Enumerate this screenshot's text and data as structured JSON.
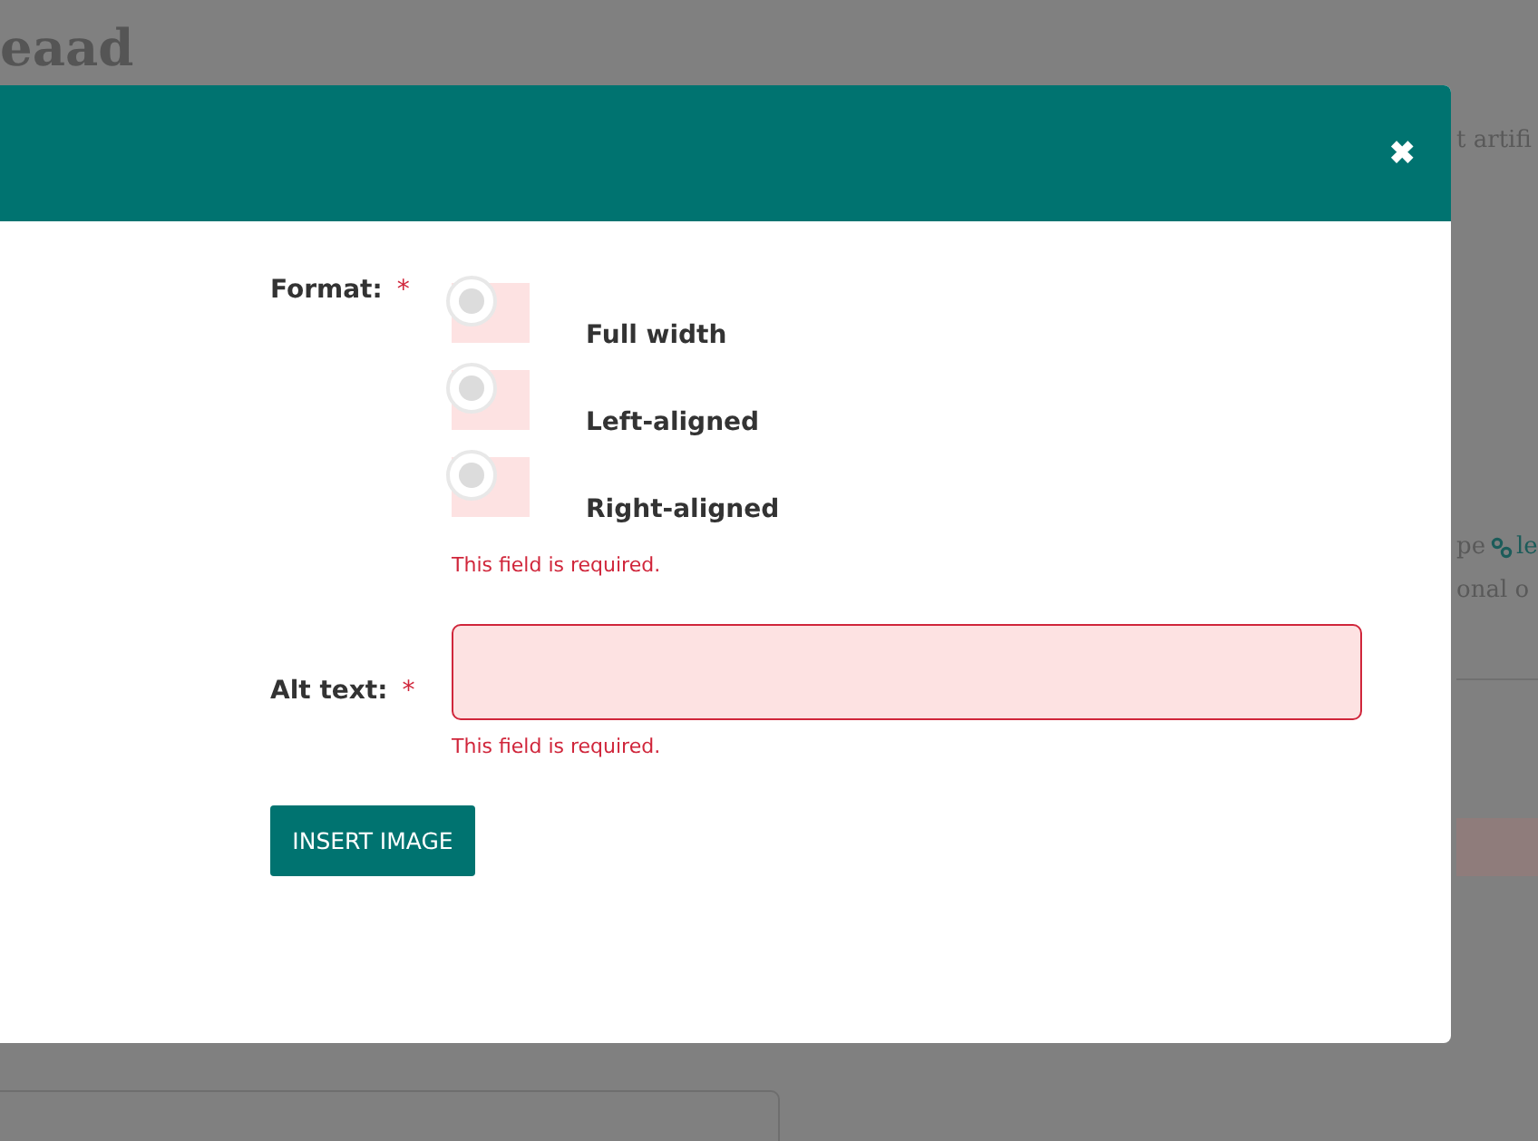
{
  "background": {
    "heading": "eaad",
    "texts": [
      "t artifi",
      "onal o"
    ],
    "link_line": {
      "before": "pe",
      "link": "le"
    }
  },
  "dialog": {
    "close": "✖",
    "format": {
      "label": "Format:",
      "required_mark": "*",
      "options": [
        {
          "label": "Full width",
          "selected": false
        },
        {
          "label": "Left-aligned",
          "selected": false
        },
        {
          "label": "Right-aligned",
          "selected": false
        }
      ],
      "error": "This field is required."
    },
    "alt_text": {
      "label": "Alt text:",
      "required_mark": "*",
      "invalid": true,
      "error": "This field is required."
    },
    "button": "INSERT IMAGE"
  }
}
